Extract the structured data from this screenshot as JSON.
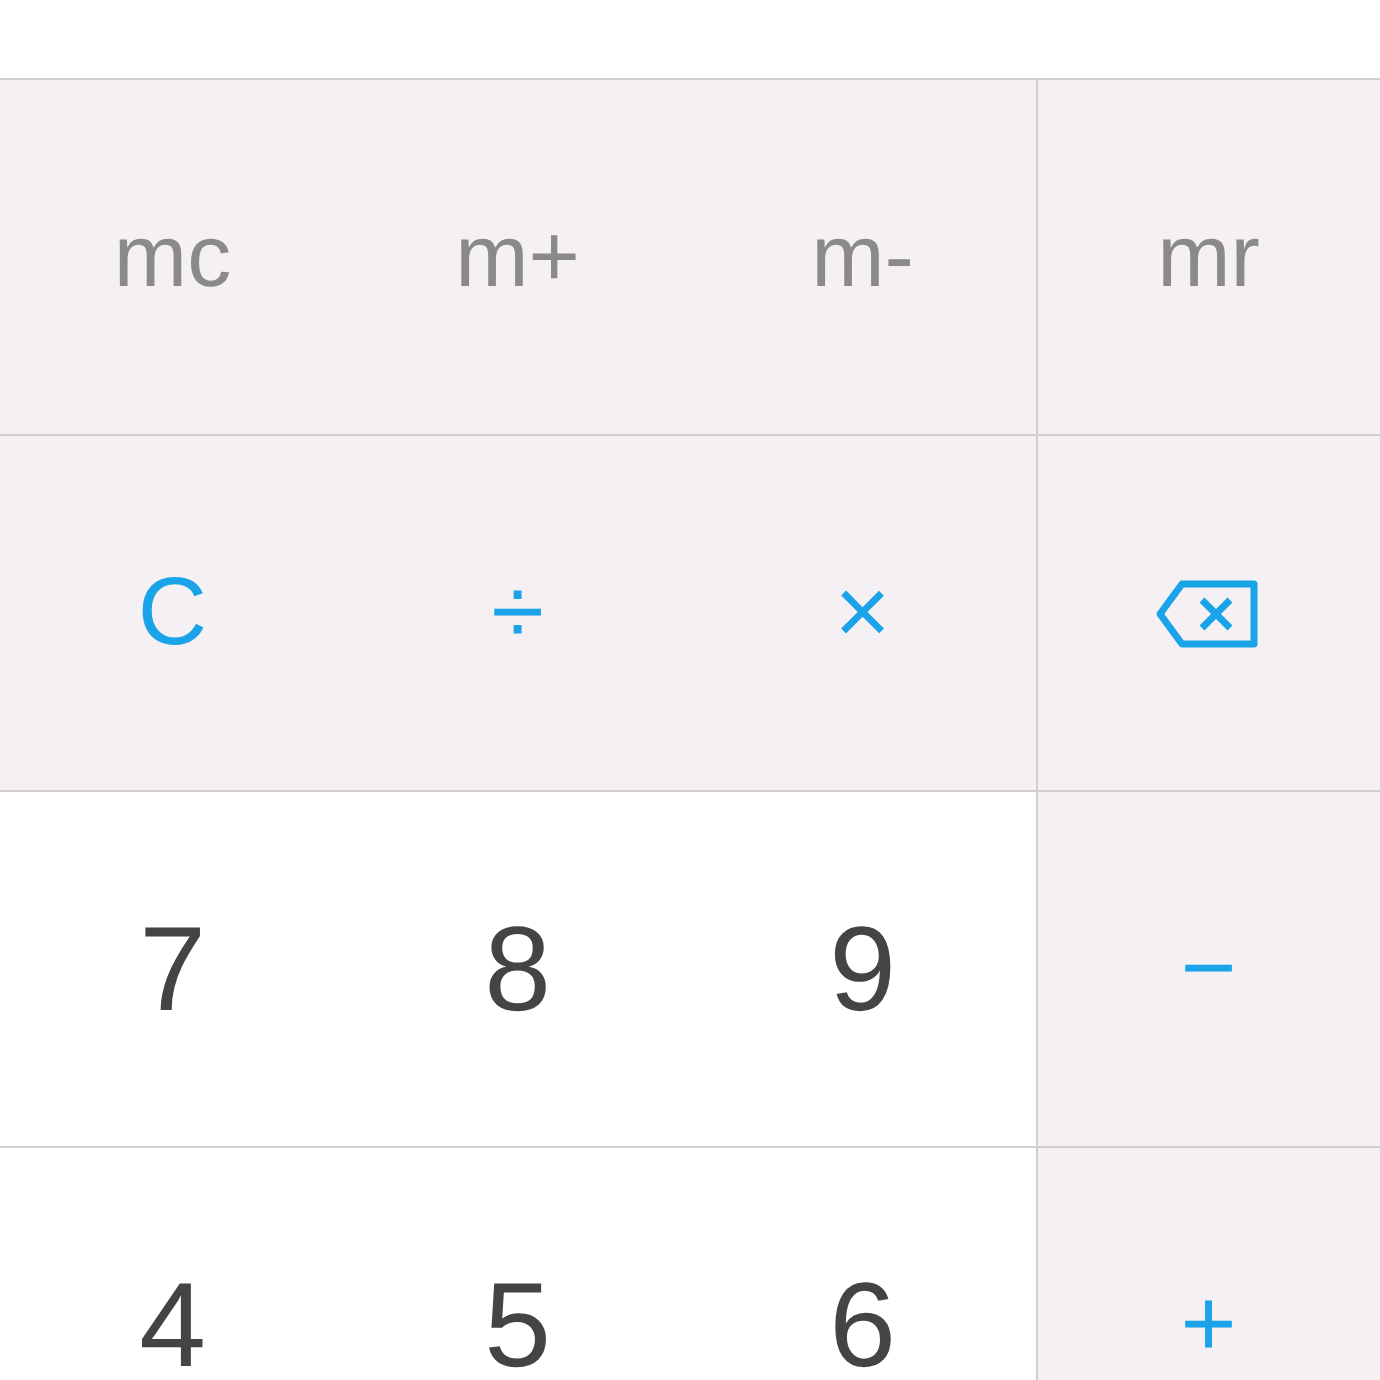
{
  "keypad": {
    "rows": [
      {
        "keys": [
          {
            "kind": "memory",
            "label": "mc"
          },
          {
            "kind": "memory",
            "label": "m+"
          },
          {
            "kind": "memory",
            "label": "m-"
          },
          {
            "kind": "memory",
            "label": "mr"
          }
        ]
      },
      {
        "keys": [
          {
            "kind": "function",
            "label": "C"
          },
          {
            "kind": "operator",
            "label": "÷"
          },
          {
            "kind": "operator",
            "label": "×"
          },
          {
            "kind": "delete"
          }
        ]
      },
      {
        "keys": [
          {
            "kind": "digit",
            "label": "7"
          },
          {
            "kind": "digit",
            "label": "8"
          },
          {
            "kind": "digit",
            "label": "9"
          },
          {
            "kind": "operator",
            "label": "−"
          }
        ]
      },
      {
        "keys": [
          {
            "kind": "digit",
            "label": "4"
          },
          {
            "kind": "digit",
            "label": "5"
          },
          {
            "kind": "digit",
            "label": "6"
          },
          {
            "kind": "operator",
            "label": "+"
          }
        ]
      }
    ]
  }
}
